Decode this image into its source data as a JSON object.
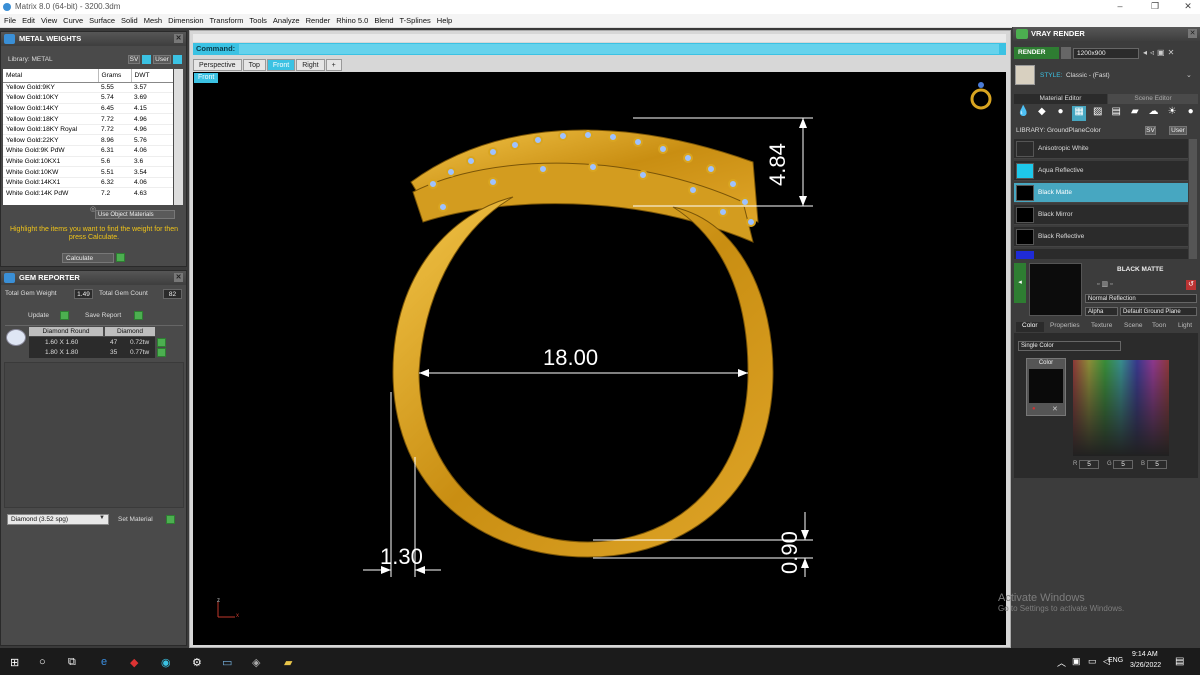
{
  "titlebar": {
    "title": "Matrix 8.0 (64-bit) - 3200.3dm",
    "minimize": "–",
    "maximize": "❐",
    "close": "✕"
  },
  "menu": [
    "File",
    "Edit",
    "View",
    "Curve",
    "Surface",
    "Solid",
    "Mesh",
    "Dimension",
    "Transform",
    "Tools",
    "Analyze",
    "Render",
    "Rhino 5.0",
    "Blend",
    "T-Splines",
    "Help"
  ],
  "metal_weights": {
    "title": "METAL WEIGHTS",
    "library_label": "Library: METAL",
    "sv_label": "SV",
    "user_label": "User",
    "columns": [
      "Metal",
      "Grams",
      "DWT"
    ],
    "rows": [
      [
        "Yellow Gold:9KY",
        "5.55",
        "3.57"
      ],
      [
        "Yellow Gold:10KY",
        "5.74",
        "3.69"
      ],
      [
        "Yellow Gold:14KY",
        "6.45",
        "4.15"
      ],
      [
        "Yellow Gold:18KY",
        "7.72",
        "4.96"
      ],
      [
        "Yellow Gold:18KY Royal",
        "7.72",
        "4.96"
      ],
      [
        "Yellow Gold:22KY",
        "8.96",
        "5.76"
      ],
      [
        "White Gold:9K PdW",
        "6.31",
        "4.06"
      ],
      [
        "White Gold:10KX1",
        "5.6",
        "3.6"
      ],
      [
        "White Gold:10KW",
        "5.51",
        "3.54"
      ],
      [
        "White Gold:14KX1",
        "6.32",
        "4.06"
      ],
      [
        "White Gold:14K PdW",
        "7.2",
        "4.63"
      ]
    ],
    "use_object_materials": "Use Object Materials",
    "hint": "Highlight the items you want to find the weight for then press Calculate.",
    "calculate": "Calculate"
  },
  "gem_reporter": {
    "title": "GEM REPORTER",
    "total_weight_label": "Total Gem Weight",
    "total_weight": "1.49",
    "total_count_label": "Total Gem Count",
    "total_count": "82",
    "update": "Update",
    "save_report": "Save Report",
    "header_shape": "Diamond Round",
    "header_type": "Diamond",
    "rows": [
      [
        "1.60 X 1.60",
        "47",
        "0.72tw"
      ],
      [
        "1.80 X 1.80",
        "35",
        "0.77tw"
      ]
    ],
    "material_select": "Diamond    (3.52 spg)",
    "set_material": "Set Material"
  },
  "viewport": {
    "command_label": "Command:",
    "tabs": [
      "Perspective",
      "Top",
      "Front",
      "Right",
      "+"
    ],
    "active_tab": "Front",
    "view_label": "Front",
    "dim_diameter": "18.00",
    "dim_height": "4.84",
    "dim_width": "1.30",
    "dim_thickness": "0.90",
    "axis_z": "z",
    "axis_x": "x"
  },
  "vray": {
    "title": "VRAY RENDER",
    "render_btn": "RENDER",
    "resolution": "1200x900",
    "style_label": "STYLE:",
    "style_value": "Classic - (Fast)",
    "tab_material": "Material Editor",
    "tab_scene": "Scene Editor",
    "library_label": "LIBRARY: GroundPlaneColor",
    "sv_label": "SV",
    "user_label": "User",
    "materials": [
      {
        "name": "Anisotropic White",
        "color": "#2b2b2b"
      },
      {
        "name": "Aqua Reflective",
        "color": "#1ec8ea"
      },
      {
        "name": "Black Matte",
        "color": "#000000"
      },
      {
        "name": "Black Mirror",
        "color": "#000000"
      },
      {
        "name": "Black Reflective",
        "color": "#000000"
      }
    ],
    "selected_material": "BLACK MATTE",
    "normal_reflection": "Normal Reflection",
    "alpha_label": "Alpha",
    "ground_plane": "Default Ground Plane",
    "prop_tabs": [
      "Color",
      "Properties",
      "Texture",
      "Scene",
      "Toon",
      "Light"
    ],
    "color_mode": "Single Color",
    "color_label": "Color",
    "r_label": "R",
    "r_value": "5",
    "g_label": "G",
    "g_value": "5",
    "b_label": "B",
    "b_value": "5"
  },
  "watermark": {
    "line1": "Activate Windows",
    "line2": "Go to Settings to activate Windows."
  },
  "taskbar": {
    "lang": "ENG",
    "time": "9:14 AM",
    "date": "3/26/2022"
  },
  "colors": {
    "accent": "#3bc2e3",
    "gold": "#d9a521",
    "gem": "#8fb8ff",
    "dimension": "#ffffff",
    "hint_text": "#f0c419"
  }
}
